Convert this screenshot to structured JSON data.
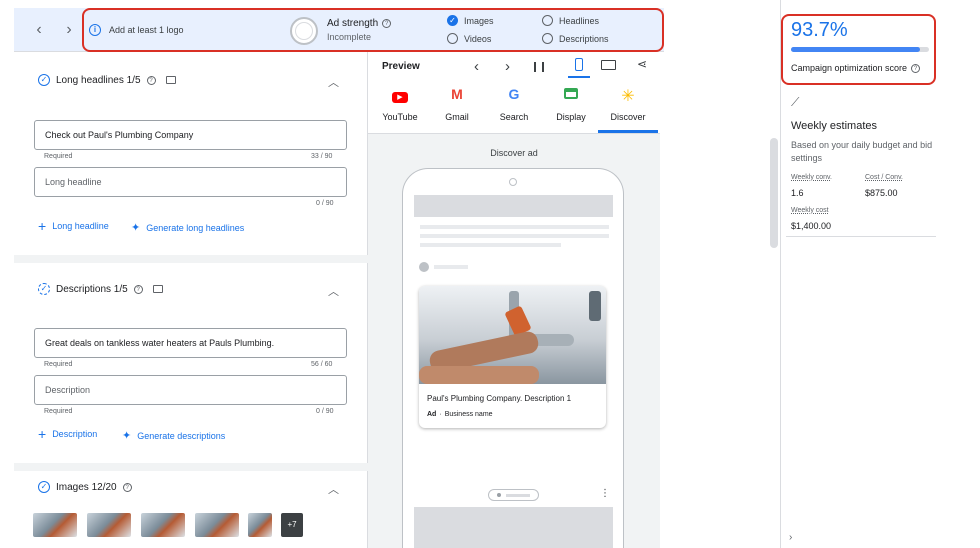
{
  "topbar": {
    "notice": "Add at least 1 logo",
    "strength_title": "Ad strength",
    "strength_status": "Incomplete",
    "checks": [
      {
        "label": "Images",
        "checked": true
      },
      {
        "label": "Headlines",
        "checked": false
      },
      {
        "label": "Videos",
        "checked": false
      },
      {
        "label": "Descriptions",
        "checked": false
      }
    ]
  },
  "long_headlines": {
    "title": "Long headlines 1/5",
    "field1_value": "Check out Paul's Plumbing Company",
    "field1_hint": "Required",
    "field1_count": "33 / 90",
    "field2_placeholder": "Long headline",
    "field2_count": "0 / 90",
    "add_label": "Long headline",
    "generate_label": "Generate long headlines"
  },
  "descriptions": {
    "title": "Descriptions 1/5",
    "field1_value": "Great deals on tankless water heaters at Pauls Plumbing.",
    "field1_hint": "Required",
    "field1_count": "56 / 60",
    "field2_placeholder": "Description",
    "field2_hint": "Required",
    "field2_count": "0 / 90",
    "add_label": "Description",
    "generate_label": "Generate descriptions"
  },
  "images": {
    "title": "Images 12/20",
    "more_count": "+7"
  },
  "preview": {
    "title": "Preview",
    "tabs": [
      {
        "label": "YouTube",
        "icon": "youtube-icon",
        "color": "#ff0000"
      },
      {
        "label": "Gmail",
        "icon": "gmail-icon",
        "color": "#ea4335"
      },
      {
        "label": "Search",
        "icon": "google-icon",
        "color": "#4285f4"
      },
      {
        "label": "Display",
        "icon": "display-icon",
        "color": "#34a853"
      },
      {
        "label": "Discover",
        "icon": "discover-icon",
        "color": "#fbbc04",
        "active": true
      }
    ],
    "ad_label": "Discover ad",
    "card_title": "Paul's Plumbing Company. Description 1",
    "card_ad_badge": "Ad",
    "card_business": "Business name"
  },
  "right": {
    "score": "93.7%",
    "score_label": "Campaign optimization score",
    "weekly_title": "Weekly estimates",
    "weekly_desc": "Based on your daily budget and bid settings",
    "conv_label": "Weekly conv.",
    "conv_value": "1.6",
    "cost_conv_label": "Cost / Conv.",
    "cost_conv_value": "$875.00",
    "cost_label": "Weekly cost",
    "cost_value": "$1,400.00"
  },
  "colors": {
    "accent": "#1a73e8",
    "highlight": "#d93025",
    "topbar_bg": "#e8f0fe"
  },
  "score_fraction": 0.937
}
